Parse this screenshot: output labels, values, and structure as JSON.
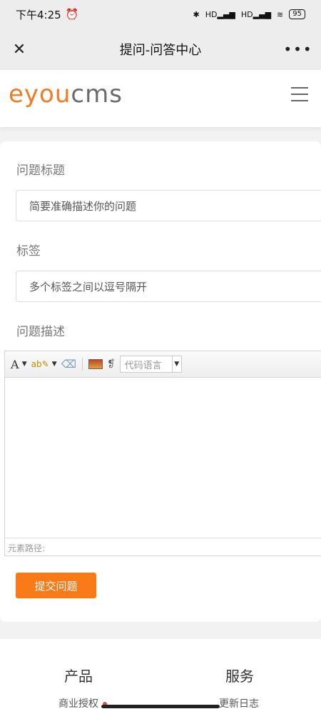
{
  "status": {
    "time": "下午4:25",
    "battery": "95",
    "signal1": "HD",
    "signal2": "HD"
  },
  "titlebar": {
    "title": "提问-问答中心"
  },
  "logo": {
    "part1": "eyou",
    "part2": "cms"
  },
  "form": {
    "title_label": "问题标题",
    "title_placeholder": "简要准确描述你的问题",
    "tags_label": "标签",
    "tags_placeholder": "多个标签之间以逗号隔开",
    "desc_label": "问题描述",
    "code_lang": "代码语言",
    "path_label": "元素路径:",
    "submit_label": "提交问题"
  },
  "footer": {
    "col1_title": "产品",
    "col1_link": "商业授权",
    "col2_title": "服务",
    "col2_link": "更新日志"
  },
  "colors": {
    "accent": "#f97a16",
    "logo_orange": "#f27b21",
    "logo_gray": "#6b6b6b"
  }
}
